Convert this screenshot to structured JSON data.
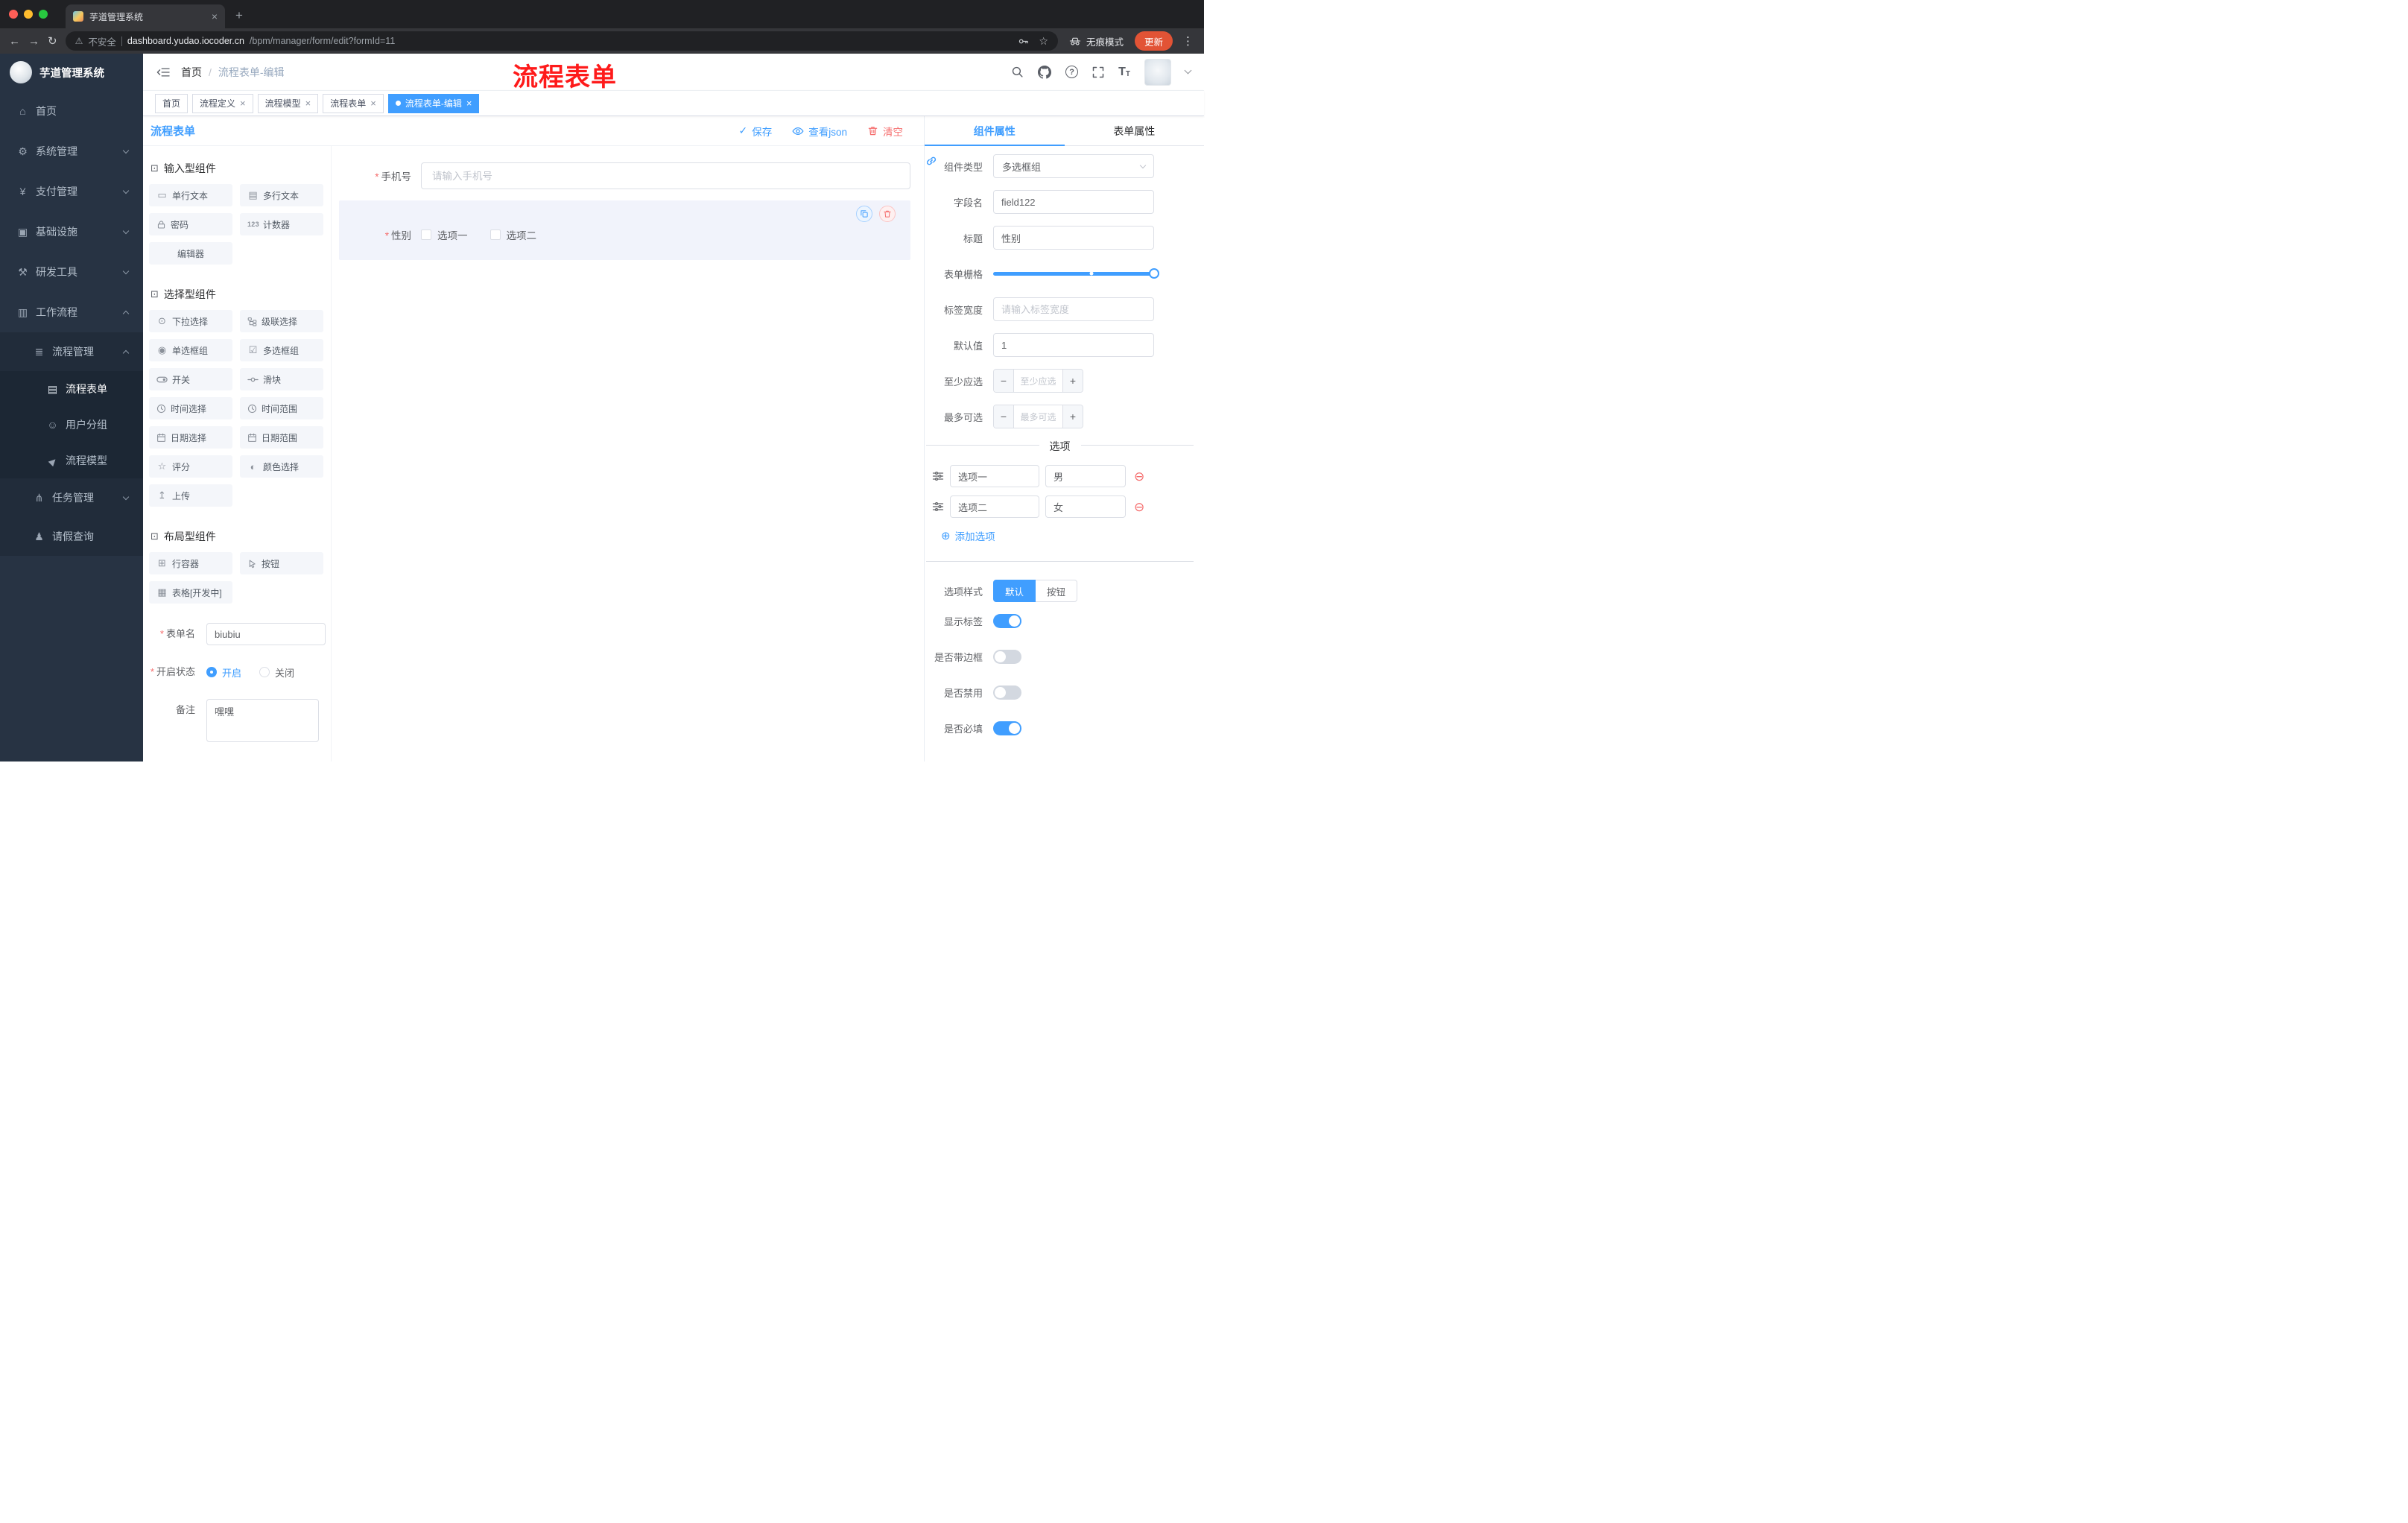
{
  "theme": {
    "accent": "#409eff",
    "danger": "#f56c6c",
    "annotation_red": "#fe1a1a",
    "sidebar_bg": "#273343",
    "chrome_bg": "#202124",
    "chrome_toolbar_bg": "#35363a",
    "update_chip": "#e25335",
    "selected_field_bg": "#f1f3fb"
  },
  "browser": {
    "tab_title": "芋道管理系统",
    "security_label": "不安全",
    "url_host": "dashboard.yudao.iocoder.cn",
    "url_path": "/bpm/manager/form/edit?formId=11",
    "incognito_label": "无痕模式",
    "update_label": "更新"
  },
  "sidebar": {
    "logo_title": "芋道管理系统",
    "items": [
      {
        "label": "首页"
      },
      {
        "label": "系统管理"
      },
      {
        "label": "支付管理"
      },
      {
        "label": "基础设施"
      },
      {
        "label": "研发工具"
      },
      {
        "label": "工作流程"
      },
      {
        "label": "流程管理"
      },
      {
        "label": "流程表单"
      },
      {
        "label": "用户分组"
      },
      {
        "label": "流程模型"
      },
      {
        "label": "任务管理"
      },
      {
        "label": "请假查询"
      }
    ]
  },
  "header": {
    "breadcrumb_home": "首页",
    "breadcrumb_current": "流程表单-编辑",
    "annotation": "流程表单"
  },
  "tags": [
    {
      "label": "首页"
    },
    {
      "label": "流程定义"
    },
    {
      "label": "流程模型"
    },
    {
      "label": "流程表单"
    },
    {
      "label": "流程表单-编辑"
    }
  ],
  "designer": {
    "panel_title": "流程表单",
    "toolbar": {
      "save": "保存",
      "view_json": "查看json",
      "clear": "清空"
    },
    "palette": {
      "groups": [
        {
          "title": "输入型组件",
          "items": [
            "单行文本",
            "多行文本",
            "密码",
            "计数器",
            "编辑器"
          ]
        },
        {
          "title": "选择型组件",
          "items": [
            "下拉选择",
            "级联选择",
            "单选框组",
            "多选框组",
            "开关",
            "滑块",
            "时间选择",
            "时间范围",
            "日期选择",
            "日期范围",
            "评分",
            "颜色选择",
            "上传"
          ]
        },
        {
          "title": "布局型组件",
          "items": [
            "行容器",
            "按钮",
            "表格[开发中]"
          ]
        }
      ]
    },
    "meta": {
      "name_label": "表单名",
      "name_value": "biubiu",
      "status_label": "开启状态",
      "status_on": "开启",
      "status_off": "关闭",
      "remark_label": "备注",
      "remark_value": "嘿嘿"
    },
    "canvas": {
      "phone_label": "手机号",
      "phone_placeholder": "请输入手机号",
      "gender_label": "性别",
      "gender_options": [
        "选项一",
        "选项二"
      ]
    }
  },
  "props": {
    "tab_component": "组件属性",
    "tab_form": "表单属性",
    "component_type_label": "组件类型",
    "component_type_value": "多选框组",
    "field_name_label": "字段名",
    "field_name_value": "field122",
    "title_label": "标题",
    "title_value": "性别",
    "grid_label": "表单栅格",
    "label_width_label": "标签宽度",
    "label_width_placeholder": "请输入标签宽度",
    "default_label": "默认值",
    "default_value": "1",
    "min_label": "至少应选",
    "min_placeholder": "至少应选",
    "max_label": "最多可选",
    "max_placeholder": "最多可选",
    "options_divider": "选项",
    "options": [
      {
        "name": "选项一",
        "value": "男"
      },
      {
        "name": "选项二",
        "value": "女"
      }
    ],
    "add_option": "添加选项",
    "style_label": "选项样式",
    "style_default": "默认",
    "style_button": "按钮",
    "switch_show_label": "显示标签",
    "switch_border": "是否带边框",
    "switch_disabled": "是否禁用",
    "switch_required": "是否必填"
  },
  "icons": {
    "asterisk": "*",
    "slash": "/",
    "check": "✓",
    "close": "×",
    "plus": "+",
    "minus": "−",
    "dots": "⋮",
    "back": "←",
    "forward": "→",
    "reload": "↻",
    "warning": "⚠",
    "star": "☆",
    "question": "?",
    "font_big": "T",
    "font_small": "T",
    "minus_circle": "⊖",
    "plus_circle": "⊕",
    "cube": "⊡",
    "home": "⌂",
    "gear": "⚙",
    "yen": "¥",
    "infra": "▣",
    "tool": "⚒",
    "work": "▥",
    "list": "≣",
    "doc": "▤",
    "users": "☺",
    "model": "▶",
    "tasks": "⋔",
    "person": "♟",
    "single_text": "▭",
    "multi_text": "▤",
    "counter": "123",
    "select": "⊙",
    "radio": "◉",
    "checkbox": "☑",
    "rate": "☆",
    "color": "◐",
    "upload": "↥",
    "row": "⊞",
    "table": "▦"
  }
}
